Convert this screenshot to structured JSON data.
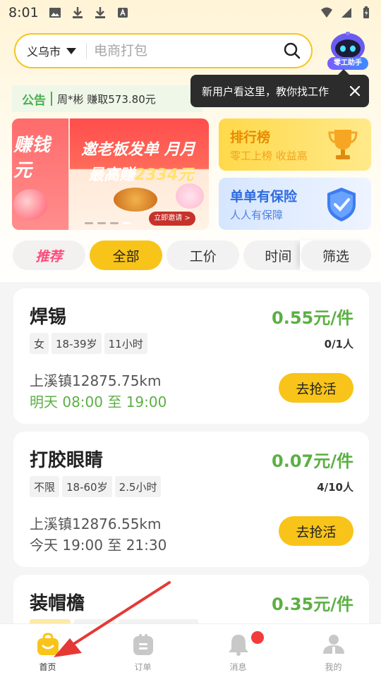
{
  "status_bar": {
    "time": "8:01"
  },
  "search": {
    "city": "义乌市",
    "placeholder": "电商打包"
  },
  "assistant": {
    "label": "零工助手"
  },
  "notice": {
    "tag": "公告",
    "text": "周*彬 赚取573.80元"
  },
  "tooltip": {
    "text": "新用户看这里，教你找工作"
  },
  "banner": {
    "left_text_line1": "赚钱",
    "left_text_line2": "元",
    "title": "邀老板发单 月月",
    "subtitle_prefix": "最高赚",
    "subtitle_number": "2334元",
    "invite_label": "立即邀请 >"
  },
  "cards": {
    "rank": {
      "title": "排行榜",
      "subtitle": "零工上榜 收益高"
    },
    "insurance": {
      "title": "单单有保险",
      "subtitle": "人人有保障"
    }
  },
  "tabs": {
    "recommend": "推荐",
    "all": "全部",
    "price": "工价",
    "time": "时间",
    "filter": "筛选"
  },
  "jobs": [
    {
      "title": "焊锡",
      "price": "0.55元/件",
      "tags": [
        "女",
        "18-39岁",
        "11小时"
      ],
      "count": "0/1人",
      "location": "上溪镇12875.75km",
      "time": "明天 08:00 至 19:00",
      "button": "去抢活"
    },
    {
      "title": "打胶眼睛",
      "price": "0.07元/件",
      "tags": [
        "不限",
        "18-60岁",
        "2.5小时"
      ],
      "count": "4/10人",
      "location": "上溪镇12876.55km",
      "time": "今天 19:00 至 21:30",
      "button": "去抢活"
    },
    {
      "title": "装帽檐",
      "price": "0.35元/件"
    }
  ],
  "nav": {
    "home": "首页",
    "orders": "订单",
    "messages": "消息",
    "mine": "我的"
  },
  "colors": {
    "accent": "#f8c419",
    "price_green": "#5bb043",
    "badge_red": "#f23b3b"
  }
}
